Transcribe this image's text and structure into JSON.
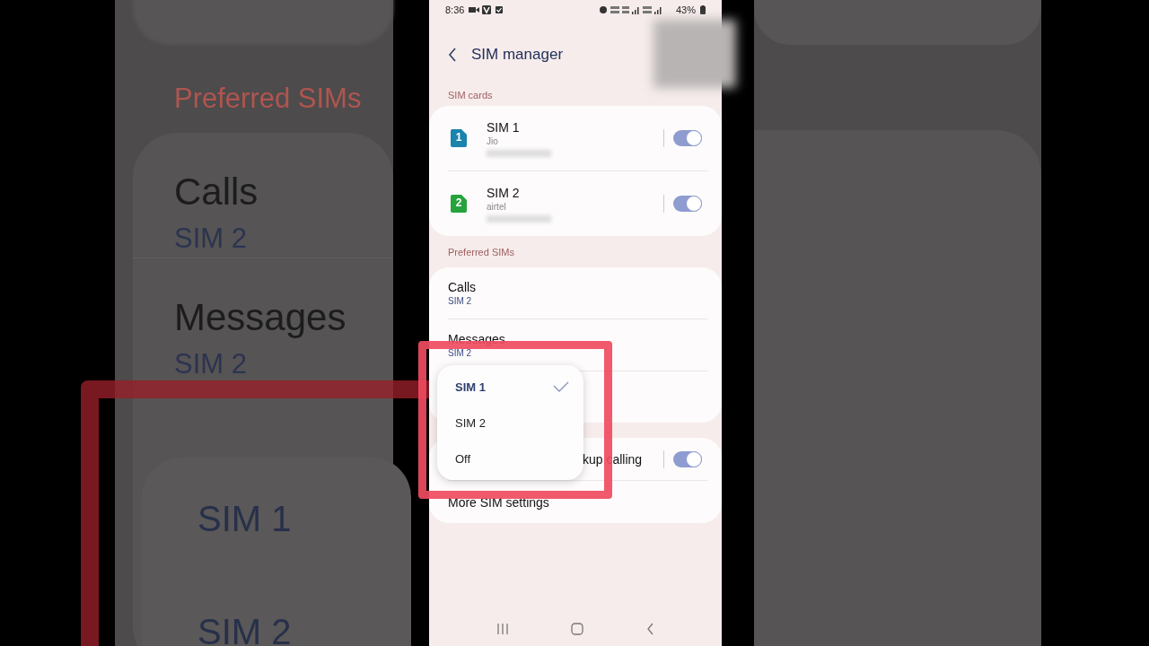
{
  "status_bar": {
    "time": "8:36",
    "battery": "43%"
  },
  "header": {
    "title": "SIM manager"
  },
  "sim_cards": {
    "heading": "SIM cards",
    "items": [
      {
        "name": "SIM 1",
        "carrier": "Jio",
        "slot": "1",
        "color": "#1a84ad",
        "on": true
      },
      {
        "name": "SIM 2",
        "carrier": "airtel",
        "slot": "2",
        "color": "#26a33d",
        "on": true
      }
    ]
  },
  "preferred_sims": {
    "heading": "Preferred SIMs",
    "items": [
      {
        "label": "Calls",
        "value": "SIM 2"
      },
      {
        "label": "Messages",
        "value": "SIM 2"
      }
    ]
  },
  "other_settings": [
    {
      "kind": "toggle",
      "label": "kup calling",
      "on": true
    },
    {
      "kind": "link",
      "label": "More SIM settings"
    }
  ],
  "popup": {
    "options": [
      {
        "label": "SIM 1",
        "selected": true
      },
      {
        "label": "SIM 2",
        "selected": false
      },
      {
        "label": "Off",
        "selected": false
      }
    ]
  },
  "background_copy": {
    "heading": "Preferred SIMs",
    "items": [
      {
        "label": "Calls",
        "value": "SIM 2"
      },
      {
        "label": "Messages",
        "value": "SIM 2"
      }
    ],
    "popup_options": [
      "SIM 1",
      "SIM 2"
    ]
  }
}
